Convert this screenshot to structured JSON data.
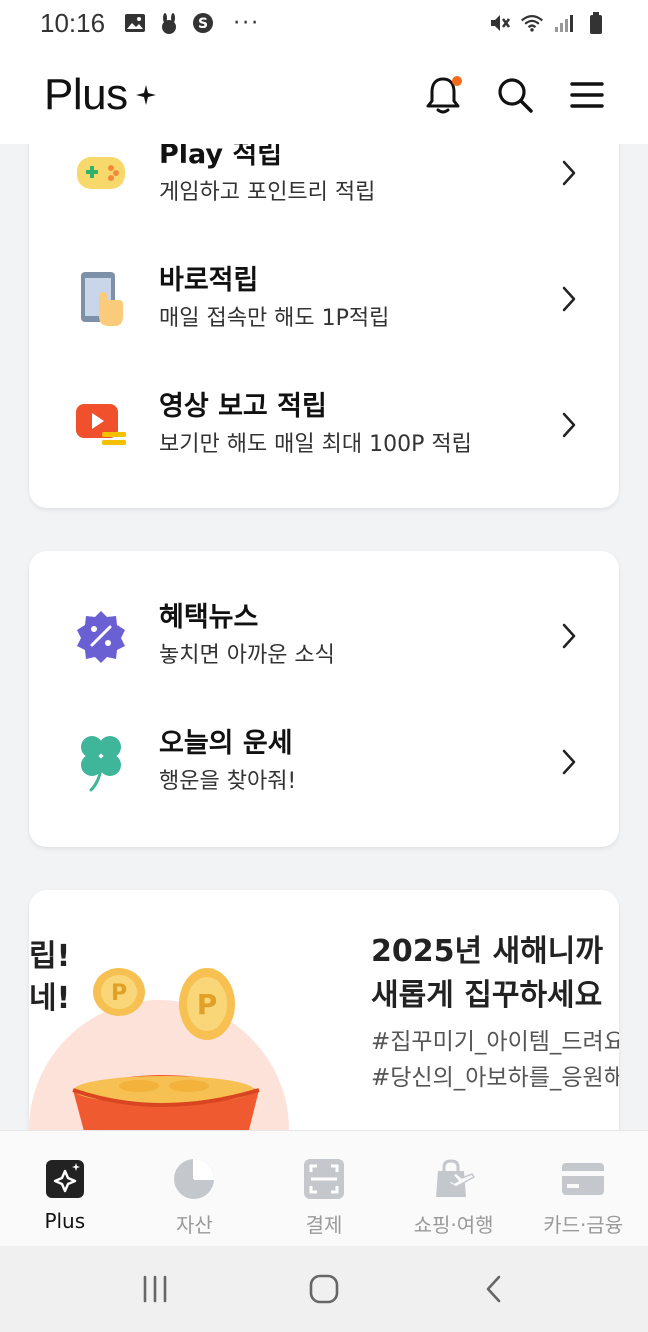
{
  "status_bar": {
    "time": "10:16",
    "more": "···"
  },
  "header": {
    "logo": "Plus"
  },
  "card1": {
    "items": [
      {
        "title": "Play 적립",
        "subtitle": "게임하고 포인트리 적립",
        "icon": "gamepad-icon"
      },
      {
        "title": "바로적립",
        "subtitle": "매일 접속만 해도 1P적립",
        "icon": "phone-tap-icon"
      },
      {
        "title": "영상 보고 적립",
        "subtitle": "보기만 해도 매일 최대 100P 적립",
        "icon": "video-play-icon"
      }
    ]
  },
  "card2": {
    "items": [
      {
        "title": "혜택뉴스",
        "subtitle": "놓치면 아까운 소식",
        "icon": "discount-badge-icon"
      },
      {
        "title": "오늘의 운세",
        "subtitle": "행운을 찾아줘!",
        "icon": "clover-icon"
      }
    ]
  },
  "banner": {
    "left_text_line1": "립!",
    "left_text_line2": "네!",
    "title_line1": "2025년 새해니까",
    "title_line2": "새롭게 집꾸하세요",
    "tag1": "#집꾸미기_아이템_드려요",
    "tag2": "#당신의_아보하를_응원해"
  },
  "bottom_nav": {
    "items": [
      {
        "label": "Plus",
        "icon": "plus-sparkle-icon",
        "active": true
      },
      {
        "label": "자산",
        "icon": "pie-chart-icon",
        "active": false
      },
      {
        "label": "결제",
        "icon": "scan-pay-icon",
        "active": false
      },
      {
        "label": "쇼핑·여행",
        "icon": "shopping-travel-icon",
        "active": false
      },
      {
        "label": "카드·금융",
        "icon": "card-icon",
        "active": false
      }
    ]
  },
  "colors": {
    "accent": "#f26b1d",
    "text": "#111111",
    "muted": "#9a9a9a"
  }
}
